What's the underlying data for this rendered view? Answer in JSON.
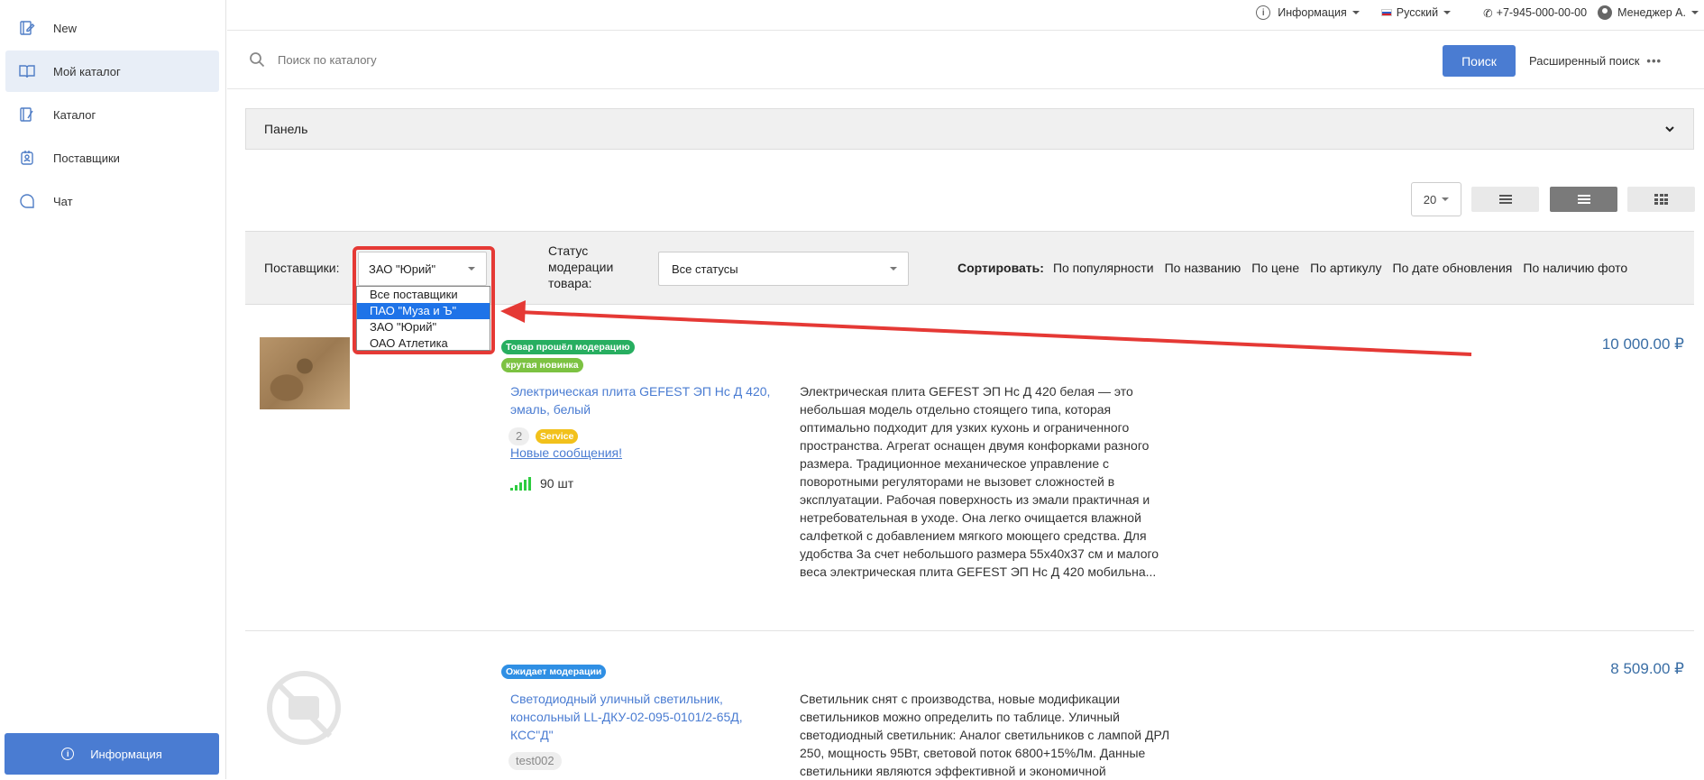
{
  "sidebar": {
    "items": [
      {
        "label": "New",
        "icon": "edit-book-icon"
      },
      {
        "label": "Мой каталог",
        "icon": "open-book-icon"
      },
      {
        "label": "Каталог",
        "icon": "catalog-icon"
      },
      {
        "label": "Поставщики",
        "icon": "supplier-icon"
      },
      {
        "label": "Чат",
        "icon": "chat-icon"
      }
    ],
    "info_button": "Информация"
  },
  "topbar": {
    "info": "Информация",
    "language": "Русский",
    "phone": "+7-945-000-00-00",
    "user": "Менеджер А."
  },
  "search": {
    "placeholder": "Поиск по каталогу",
    "button": "Поиск",
    "advanced": "Расширенный поиск",
    "advanced_more": "•••"
  },
  "panel": {
    "title": "Панель"
  },
  "view": {
    "per_page": "20"
  },
  "filters": {
    "suppliers_label": "Поставщики:",
    "supplier_selected": "ЗАО \"Юрий\"",
    "supplier_options": [
      "Все поставщики",
      "ПАО \"Муза и Ъ\"",
      "ЗАО \"Юрий\"",
      "ОАО Атлетика"
    ],
    "status_label_1": "Статус",
    "status_label_2": "модерации",
    "status_label_3": "товара:",
    "status_selected": "Все статусы",
    "sort_label": "Сортировать:",
    "sort_options": [
      "По популярности",
      "По названию",
      "По цене",
      "По артикулу",
      "По дате обновления",
      "По наличию фото"
    ]
  },
  "products": [
    {
      "badges": [
        "Товар прошёл модерацию",
        "крутая новинка"
      ],
      "title": "Электрическая плита GEFEST ЭП Нс Д 420, эмаль, белый",
      "count": "2",
      "tag": "Service",
      "new_messages": "Новые сообщения!",
      "stock": "90 шт",
      "description": "Электрическая плита GEFEST ЭП Нс Д 420 белая — это небольшая модель отдельно стоящего типа, которая оптимально подходит для узких кухонь и ограниченного пространства. Агрегат оснащен двумя конфорками разного размера. Традиционное механическое управление с поворотными регуляторами не вызовет сложностей в эксплуатации. Рабочая поверхность из эмали практичная и нетребовательная в уходе. Она легко очищается влажной салфеткой с добавлением мягкого моющего средства. Для удобства За счет небольшого размера 55x40x37 см и малого веса электрическая плита GEFEST ЭП Нс Д 420 мобильна...",
      "price": "10 000.00 ₽"
    },
    {
      "badges": [
        "Ожидает модерации"
      ],
      "title": "Светодиодный уличный светильник, консольный LL-ДКУ-02-095-0101/2-65Д, КСС\"Д\"",
      "tag": "test002",
      "description": "Светильник снят с производства, новые модификации светильников можно определить по таблице. Уличный светодиодный светильник: Аналог светильников с лампой ДРЛ 250, мощность 95Вт, световой поток 6800+15%Лм. Данные светильники являются эффективной и экономичной",
      "price": "8 509.00 ₽"
    }
  ],
  "colors": {
    "accent": "#4a7cd2",
    "annotation": "#e53935"
  }
}
